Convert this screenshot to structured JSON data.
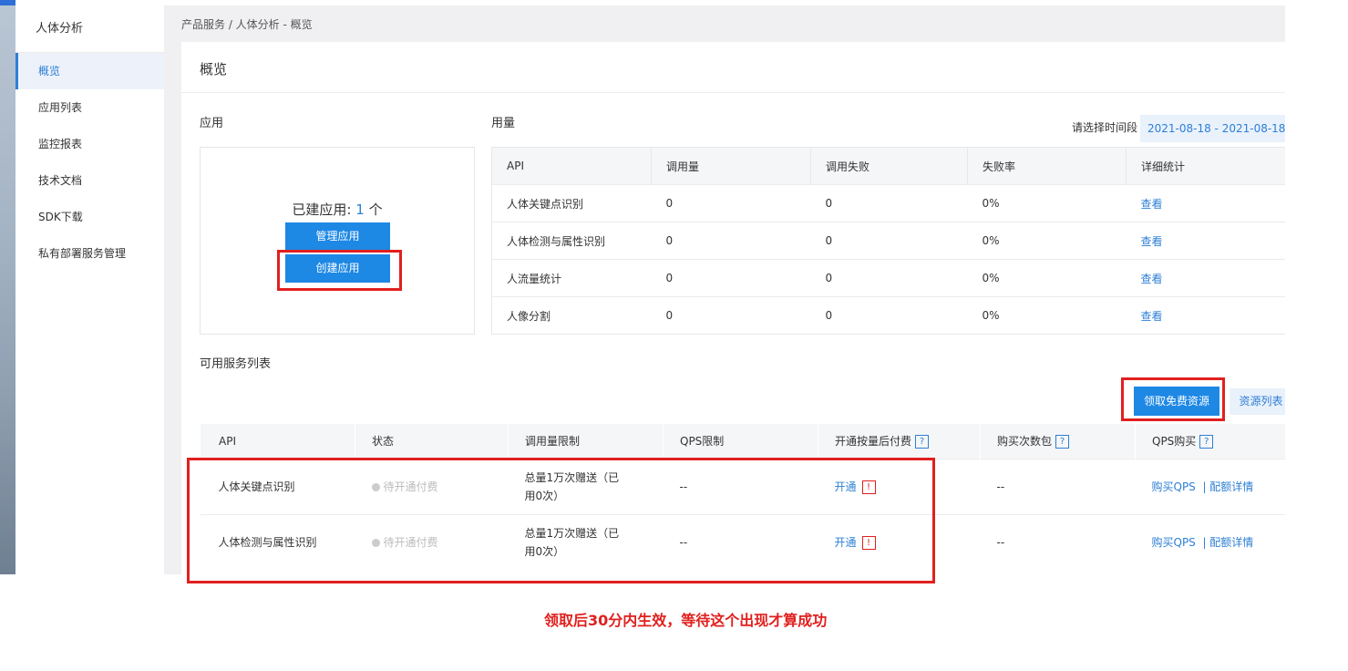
{
  "sidebar": {
    "title": "人体分析",
    "items": [
      {
        "label": "概览"
      },
      {
        "label": "应用列表"
      },
      {
        "label": "监控报表"
      },
      {
        "label": "技术文档"
      },
      {
        "label": "SDK下载"
      },
      {
        "label": "私有部署服务管理"
      }
    ]
  },
  "breadcrumb": "产品服务 / 人体分析 - 概览",
  "page_title": "概览",
  "apps": {
    "section_label": "应用",
    "created_prefix": "已建应用: ",
    "created_count": "1",
    "created_suffix": " 个",
    "manage_label": "管理应用",
    "create_label": "创建应用"
  },
  "usage": {
    "section_label": "用量",
    "date_hint": "请选择时间段",
    "date_range": "2021-08-18 - 2021-08-18",
    "columns": [
      "API",
      "调用量",
      "调用失败",
      "失败率",
      "详细统计"
    ],
    "rows": [
      {
        "api": "人体关键点识别",
        "calls": "0",
        "failed": "0",
        "rate": "0%",
        "detail": "查看"
      },
      {
        "api": "人体检测与属性识别",
        "calls": "0",
        "failed": "0",
        "rate": "0%",
        "detail": "查看"
      },
      {
        "api": "人流量统计",
        "calls": "0",
        "failed": "0",
        "rate": "0%",
        "detail": "查看"
      },
      {
        "api": "人像分割",
        "calls": "0",
        "failed": "0",
        "rate": "0%",
        "detail": "查看"
      }
    ]
  },
  "services": {
    "section_label": "可用服务列表",
    "claim_label": "领取免费资源",
    "resource_list_label": "资源列表",
    "columns": [
      "API",
      "状态",
      "调用量限制",
      "QPS限制",
      "开通按量后付费",
      "购买次数包",
      "QPS购买"
    ],
    "help_mark": "?",
    "warn_mark": "!",
    "rows": [
      {
        "api": "人体关键点识别",
        "status": "待开通付费",
        "limit": "总量1万次赠送（已用0次）",
        "qps": "--",
        "open": "开通",
        "pack": "--",
        "buy_qps": "购买QPS",
        "quota": "| 配额详情"
      },
      {
        "api": "人体检测与属性识别",
        "status": "待开通付费",
        "limit": "总量1万次赠送（已用0次）",
        "qps": "--",
        "open": "开通",
        "pack": "--",
        "buy_qps": "购买QPS",
        "quota": "| 配额详情"
      }
    ]
  },
  "annotation": "领取后30分内生效，等待这个出现才算成功",
  "colors": {
    "accent": "#1e88e5",
    "link": "#2d7fd6",
    "highlight": "#e0201e"
  }
}
